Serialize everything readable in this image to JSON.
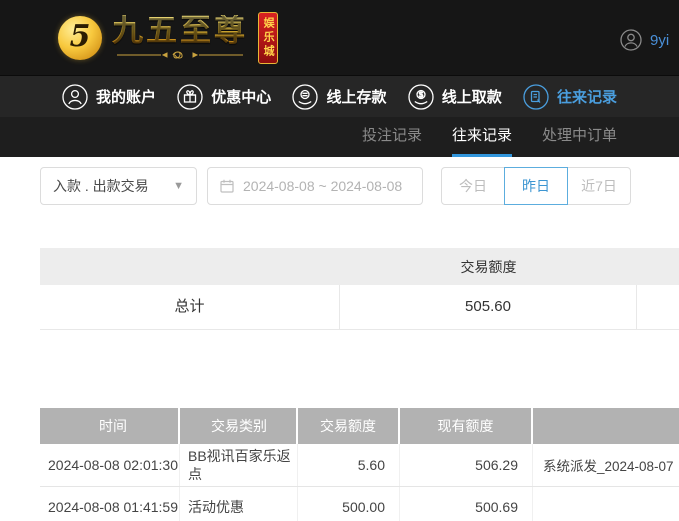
{
  "header": {
    "logo": {
      "emblem": "5",
      "title": "九五至尊",
      "badge": "娱乐城"
    },
    "user": {
      "name": "9yi"
    }
  },
  "nav": {
    "items": [
      {
        "label": "我的账户",
        "icon": "user-icon",
        "active": false
      },
      {
        "label": "优惠中心",
        "icon": "gift-icon",
        "active": false
      },
      {
        "label": "线上存款",
        "icon": "deposit-icon",
        "active": false
      },
      {
        "label": "线上取款",
        "icon": "withdraw-icon",
        "active": false
      },
      {
        "label": "往来记录",
        "icon": "records-icon",
        "active": true
      }
    ]
  },
  "tabs": {
    "items": [
      {
        "label": "投注记录",
        "active": false
      },
      {
        "label": "往来记录",
        "active": true
      },
      {
        "label": "处理中订单",
        "active": false
      }
    ]
  },
  "filters": {
    "type_select": {
      "value": "入款 . 出款交易",
      "caret_icon": "▼"
    },
    "date_range": {
      "value": "2024-08-08 ~ 2024-08-08",
      "icon": "calendar-icon"
    },
    "quick_ranges": [
      {
        "label": "今日",
        "active": false
      },
      {
        "label": "昨日",
        "active": true
      },
      {
        "label": "近7日",
        "active": false
      }
    ]
  },
  "summary_table": {
    "header": [
      "",
      "交易额度",
      ""
    ],
    "rows": [
      [
        "总计",
        "505.60",
        ""
      ]
    ]
  },
  "transactions_table": {
    "columns": [
      "时间",
      "交易类别",
      "交易额度",
      "现有额度",
      ""
    ],
    "rows": [
      {
        "time": "2024-08-08 02:01:30",
        "type": "BB视讯百家乐返点",
        "amount": "5.60",
        "balance": "506.29",
        "remark": "系统派发_2024-08-07"
      },
      {
        "time": "2024-08-08 01:41:59",
        "type": "活动优惠",
        "amount": "500.00",
        "balance": "500.69",
        "remark": ""
      }
    ]
  },
  "colors": {
    "accent_blue": "#3d96d2",
    "nav_active_blue": "#4a9ede",
    "gold": "#f0b429",
    "badge_red": "#c01818",
    "table_header_gray": "#b2b2b2"
  }
}
